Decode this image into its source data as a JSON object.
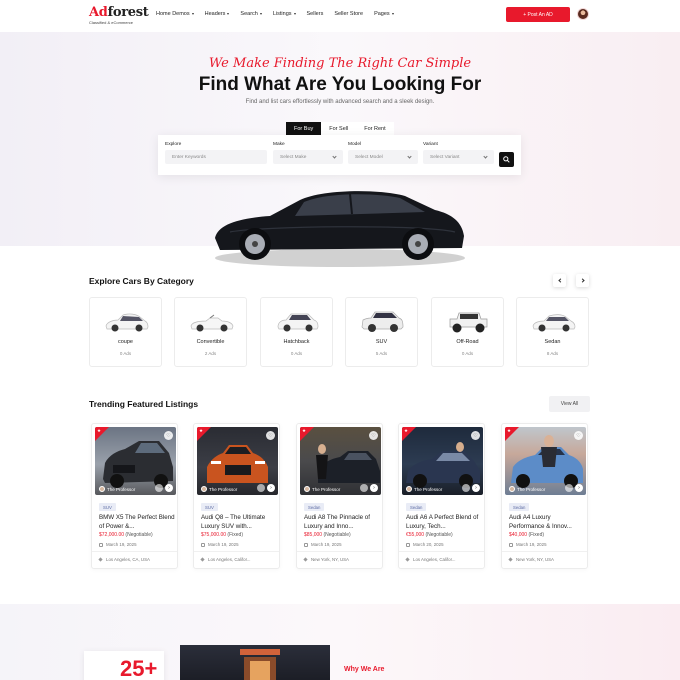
{
  "header": {
    "logo_brand_red": "Ad",
    "logo_brand_rest": "forest",
    "logo_tagline": "Classified & eCommerce",
    "nav": [
      {
        "label": "Home Demos",
        "dropdown": true
      },
      {
        "label": "Headers",
        "dropdown": true
      },
      {
        "label": "Search",
        "dropdown": true
      },
      {
        "label": "Listings",
        "dropdown": true
      },
      {
        "label": "Sellers",
        "dropdown": false
      },
      {
        "label": "Seller Store",
        "dropdown": false
      },
      {
        "label": "Pages",
        "dropdown": true
      }
    ],
    "post_ad_label": "+ Post An AD"
  },
  "hero": {
    "tagline": "We Make Finding The Right Car Simple",
    "headline": "Find What Are You Looking For",
    "subline": "Find and list cars effortlessly with advanced search and a sleek design.",
    "tabs": [
      "For Buy",
      "For Sell",
      "For Rent"
    ],
    "active_tab": "For Buy",
    "search": {
      "explore_label": "Explore",
      "explore_placeholder": "Enter Keywords",
      "make_label": "Make",
      "make_value": "Select Make",
      "model_label": "Model",
      "model_value": "Select Model",
      "variant_label": "Variant",
      "variant_value": "Select Variant"
    }
  },
  "categories": {
    "title": "Explore Cars By Category",
    "items": [
      {
        "name": "coupe",
        "count": "0 Ads"
      },
      {
        "name": "Convertible",
        "count": "2 Ads"
      },
      {
        "name": "Hatchback",
        "count": "0 Ads"
      },
      {
        "name": "SUV",
        "count": "5 Ads"
      },
      {
        "name": "Off-Road",
        "count": "0 Ads"
      },
      {
        "name": "Sedan",
        "count": "8 Ads"
      }
    ]
  },
  "trending": {
    "title": "Trending Featured Listings",
    "view_all": "View All",
    "author": "The Professor",
    "listings": [
      {
        "badge": "SUV",
        "title": "BMW X5 The Perfect Blend of Power &...",
        "price": "$72,000.00",
        "price_note": "(Negotiable)",
        "date": "March 19, 2025",
        "location": "Los Angeles, CA, USA"
      },
      {
        "badge": "SUV",
        "title": "Audi Q8 – The Ultimate Luxury SUV with...",
        "price": "$75,000.00",
        "price_note": "(Fixed)",
        "date": "March 19, 2025",
        "location": "Los Angeles, Califor..."
      },
      {
        "badge": "Sedan",
        "title": "Audi A8 The Pinnacle of Luxury and Inno...",
        "price": "$85,000",
        "price_note": "(Negotiable)",
        "date": "March 19, 2025",
        "location": "New York, NY, USA"
      },
      {
        "badge": "Sedan",
        "title": "Audi A6 A Perfect Blend of Luxury, Tech...",
        "price": "€55,000",
        "price_note": "(Negotiable)",
        "date": "March 20, 2025",
        "location": "Los Angeles, Califor..."
      },
      {
        "badge": "Sedan",
        "title": "Audi A4 Luxury Performance & Innov...",
        "price": "$40,000",
        "price_note": "(Fixed)",
        "date": "March 19, 2025",
        "location": "New York, NY, USA"
      }
    ]
  },
  "bottom": {
    "stat": "25+",
    "why_label": "Why We Are"
  },
  "colors": {
    "accent": "#e8192c",
    "dark": "#111111"
  }
}
